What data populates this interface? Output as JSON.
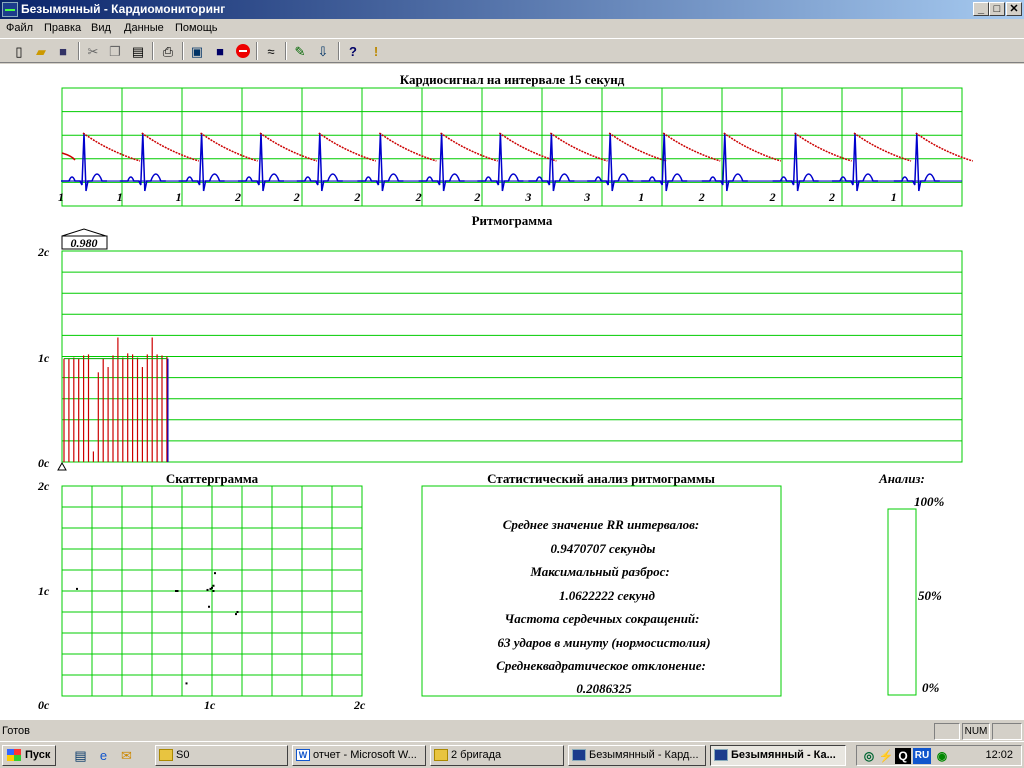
{
  "window": {
    "title": "Безымянный - Кардиомониторинг",
    "controls": {
      "minimize": "_",
      "maximize": "□",
      "close": "✕"
    }
  },
  "menu": [
    "Файл",
    "Правка",
    "Вид",
    "Данные",
    "Помощь"
  ],
  "toolbar_icons": [
    "new-icon",
    "open-icon",
    "save-icon",
    "cut-icon",
    "copy-icon",
    "paste-icon",
    "print-icon",
    "monitor-icon",
    "disk-icon",
    "stop-icon",
    "signal-icon",
    "edit-icon",
    "export-icon",
    "help-icon",
    "exclamation-icon"
  ],
  "colors": {
    "grid": "#00cc00",
    "waveform": "#0000cc",
    "decay": "#cc0000",
    "rhythm_bar": "#cc0000"
  },
  "cardio": {
    "title": "Кардиосигнал на интервале 15 секунд",
    "beat_labels": [
      "1",
      "1",
      "1",
      "2",
      "2",
      "2",
      "2",
      "2",
      "3",
      "3",
      "1",
      "2",
      "2",
      "2",
      "1"
    ]
  },
  "rhythmogram": {
    "title": "Ритмограмма",
    "value_box": "0.980",
    "y_labels": [
      "2с",
      "1с",
      "0с"
    ],
    "rr_intervals": [
      0.98,
      0.98,
      0.99,
      0.98,
      1.01,
      1.02,
      0.1,
      0.85,
      0.98,
      0.9,
      1.01,
      1.18,
      0.99,
      1.03,
      1.02,
      0.99,
      0.9,
      1.02,
      1.18,
      1.02,
      1.01,
      1.0
    ]
  },
  "scattergram": {
    "title": "Скаттерграмма",
    "y_labels": [
      "2с",
      "1с",
      "0с"
    ],
    "x_labels": [
      "1с",
      "2с"
    ],
    "points": [
      [
        0.1,
        1.02
      ],
      [
        0.76,
        1.0
      ],
      [
        0.77,
        1.0
      ],
      [
        0.97,
        1.01
      ],
      [
        0.99,
        1.02
      ],
      [
        1.0,
        1.03
      ],
      [
        1.01,
        1.05
      ],
      [
        1.02,
        1.17
      ],
      [
        0.98,
        0.85
      ],
      [
        1.17,
        0.8
      ],
      [
        1.16,
        0.78
      ],
      [
        0.83,
        0.12
      ],
      [
        1.01,
        1.0
      ]
    ]
  },
  "statistics": {
    "title": "Статистический анализ ритмограммы",
    "mean_label": "Среднее значение RR интервалов:",
    "mean_value": "0.9470707 секунды",
    "range_label": "Максимальный разброс:",
    "range_value": "1.0622222 секунд",
    "hr_label": "Частота сердечных сокращений:",
    "hr_value": "63 ударов в минуту (нормосистолия)",
    "std_label": "Среднеквадратическое отклонение:",
    "std_value": "0.2086325"
  },
  "analysis": {
    "title": "Анализ:",
    "labels": [
      "100%",
      "50%",
      "0%"
    ],
    "level": 0
  },
  "status": {
    "text": "Готов",
    "num": "NUM"
  },
  "taskbar": {
    "start": "Пуск",
    "tasks": [
      "S0",
      "отчет - Microsoft W...",
      "2 бригада",
      "Безымянный - Кард...",
      "Безымянный - Ка..."
    ],
    "clock": "12:02",
    "lang": "RU"
  }
}
